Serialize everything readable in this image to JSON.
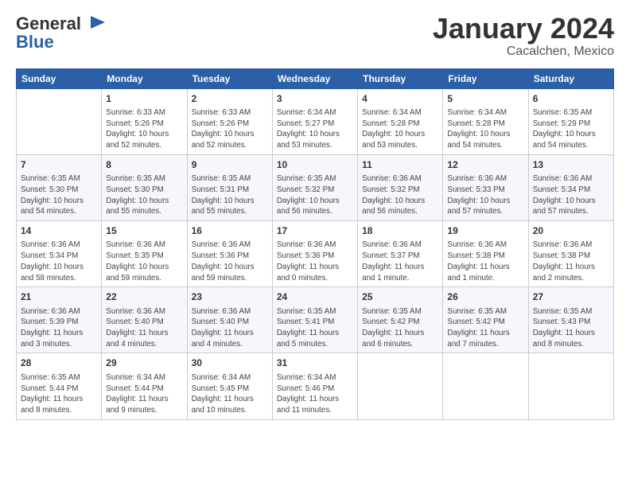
{
  "logo": {
    "general": "General",
    "blue": "Blue"
  },
  "title": "January 2024",
  "location": "Cacalchen, Mexico",
  "days_of_week": [
    "Sunday",
    "Monday",
    "Tuesday",
    "Wednesday",
    "Thursday",
    "Friday",
    "Saturday"
  ],
  "weeks": [
    [
      {
        "day": "",
        "sunrise": "",
        "sunset": "",
        "daylight": ""
      },
      {
        "day": "1",
        "sunrise": "Sunrise: 6:33 AM",
        "sunset": "Sunset: 5:26 PM",
        "daylight": "Daylight: 10 hours and 52 minutes."
      },
      {
        "day": "2",
        "sunrise": "Sunrise: 6:33 AM",
        "sunset": "Sunset: 5:26 PM",
        "daylight": "Daylight: 10 hours and 52 minutes."
      },
      {
        "day": "3",
        "sunrise": "Sunrise: 6:34 AM",
        "sunset": "Sunset: 5:27 PM",
        "daylight": "Daylight: 10 hours and 53 minutes."
      },
      {
        "day": "4",
        "sunrise": "Sunrise: 6:34 AM",
        "sunset": "Sunset: 5:28 PM",
        "daylight": "Daylight: 10 hours and 53 minutes."
      },
      {
        "day": "5",
        "sunrise": "Sunrise: 6:34 AM",
        "sunset": "Sunset: 5:28 PM",
        "daylight": "Daylight: 10 hours and 54 minutes."
      },
      {
        "day": "6",
        "sunrise": "Sunrise: 6:35 AM",
        "sunset": "Sunset: 5:29 PM",
        "daylight": "Daylight: 10 hours and 54 minutes."
      }
    ],
    [
      {
        "day": "7",
        "sunrise": "Sunrise: 6:35 AM",
        "sunset": "Sunset: 5:30 PM",
        "daylight": "Daylight: 10 hours and 54 minutes."
      },
      {
        "day": "8",
        "sunrise": "Sunrise: 6:35 AM",
        "sunset": "Sunset: 5:30 PM",
        "daylight": "Daylight: 10 hours and 55 minutes."
      },
      {
        "day": "9",
        "sunrise": "Sunrise: 6:35 AM",
        "sunset": "Sunset: 5:31 PM",
        "daylight": "Daylight: 10 hours and 55 minutes."
      },
      {
        "day": "10",
        "sunrise": "Sunrise: 6:35 AM",
        "sunset": "Sunset: 5:32 PM",
        "daylight": "Daylight: 10 hours and 56 minutes."
      },
      {
        "day": "11",
        "sunrise": "Sunrise: 6:36 AM",
        "sunset": "Sunset: 5:32 PM",
        "daylight": "Daylight: 10 hours and 56 minutes."
      },
      {
        "day": "12",
        "sunrise": "Sunrise: 6:36 AM",
        "sunset": "Sunset: 5:33 PM",
        "daylight": "Daylight: 10 hours and 57 minutes."
      },
      {
        "day": "13",
        "sunrise": "Sunrise: 6:36 AM",
        "sunset": "Sunset: 5:34 PM",
        "daylight": "Daylight: 10 hours and 57 minutes."
      }
    ],
    [
      {
        "day": "14",
        "sunrise": "Sunrise: 6:36 AM",
        "sunset": "Sunset: 5:34 PM",
        "daylight": "Daylight: 10 hours and 58 minutes."
      },
      {
        "day": "15",
        "sunrise": "Sunrise: 6:36 AM",
        "sunset": "Sunset: 5:35 PM",
        "daylight": "Daylight: 10 hours and 59 minutes."
      },
      {
        "day": "16",
        "sunrise": "Sunrise: 6:36 AM",
        "sunset": "Sunset: 5:36 PM",
        "daylight": "Daylight: 10 hours and 59 minutes."
      },
      {
        "day": "17",
        "sunrise": "Sunrise: 6:36 AM",
        "sunset": "Sunset: 5:36 PM",
        "daylight": "Daylight: 11 hours and 0 minutes."
      },
      {
        "day": "18",
        "sunrise": "Sunrise: 6:36 AM",
        "sunset": "Sunset: 5:37 PM",
        "daylight": "Daylight: 11 hours and 1 minute."
      },
      {
        "day": "19",
        "sunrise": "Sunrise: 6:36 AM",
        "sunset": "Sunset: 5:38 PM",
        "daylight": "Daylight: 11 hours and 1 minute."
      },
      {
        "day": "20",
        "sunrise": "Sunrise: 6:36 AM",
        "sunset": "Sunset: 5:38 PM",
        "daylight": "Daylight: 11 hours and 2 minutes."
      }
    ],
    [
      {
        "day": "21",
        "sunrise": "Sunrise: 6:36 AM",
        "sunset": "Sunset: 5:39 PM",
        "daylight": "Daylight: 11 hours and 3 minutes."
      },
      {
        "day": "22",
        "sunrise": "Sunrise: 6:36 AM",
        "sunset": "Sunset: 5:40 PM",
        "daylight": "Daylight: 11 hours and 4 minutes."
      },
      {
        "day": "23",
        "sunrise": "Sunrise: 6:36 AM",
        "sunset": "Sunset: 5:40 PM",
        "daylight": "Daylight: 11 hours and 4 minutes."
      },
      {
        "day": "24",
        "sunrise": "Sunrise: 6:35 AM",
        "sunset": "Sunset: 5:41 PM",
        "daylight": "Daylight: 11 hours and 5 minutes."
      },
      {
        "day": "25",
        "sunrise": "Sunrise: 6:35 AM",
        "sunset": "Sunset: 5:42 PM",
        "daylight": "Daylight: 11 hours and 6 minutes."
      },
      {
        "day": "26",
        "sunrise": "Sunrise: 6:35 AM",
        "sunset": "Sunset: 5:42 PM",
        "daylight": "Daylight: 11 hours and 7 minutes."
      },
      {
        "day": "27",
        "sunrise": "Sunrise: 6:35 AM",
        "sunset": "Sunset: 5:43 PM",
        "daylight": "Daylight: 11 hours and 8 minutes."
      }
    ],
    [
      {
        "day": "28",
        "sunrise": "Sunrise: 6:35 AM",
        "sunset": "Sunset: 5:44 PM",
        "daylight": "Daylight: 11 hours and 8 minutes."
      },
      {
        "day": "29",
        "sunrise": "Sunrise: 6:34 AM",
        "sunset": "Sunset: 5:44 PM",
        "daylight": "Daylight: 11 hours and 9 minutes."
      },
      {
        "day": "30",
        "sunrise": "Sunrise: 6:34 AM",
        "sunset": "Sunset: 5:45 PM",
        "daylight": "Daylight: 11 hours and 10 minutes."
      },
      {
        "day": "31",
        "sunrise": "Sunrise: 6:34 AM",
        "sunset": "Sunset: 5:46 PM",
        "daylight": "Daylight: 11 hours and 11 minutes."
      },
      {
        "day": "",
        "sunrise": "",
        "sunset": "",
        "daylight": ""
      },
      {
        "day": "",
        "sunrise": "",
        "sunset": "",
        "daylight": ""
      },
      {
        "day": "",
        "sunrise": "",
        "sunset": "",
        "daylight": ""
      }
    ]
  ]
}
